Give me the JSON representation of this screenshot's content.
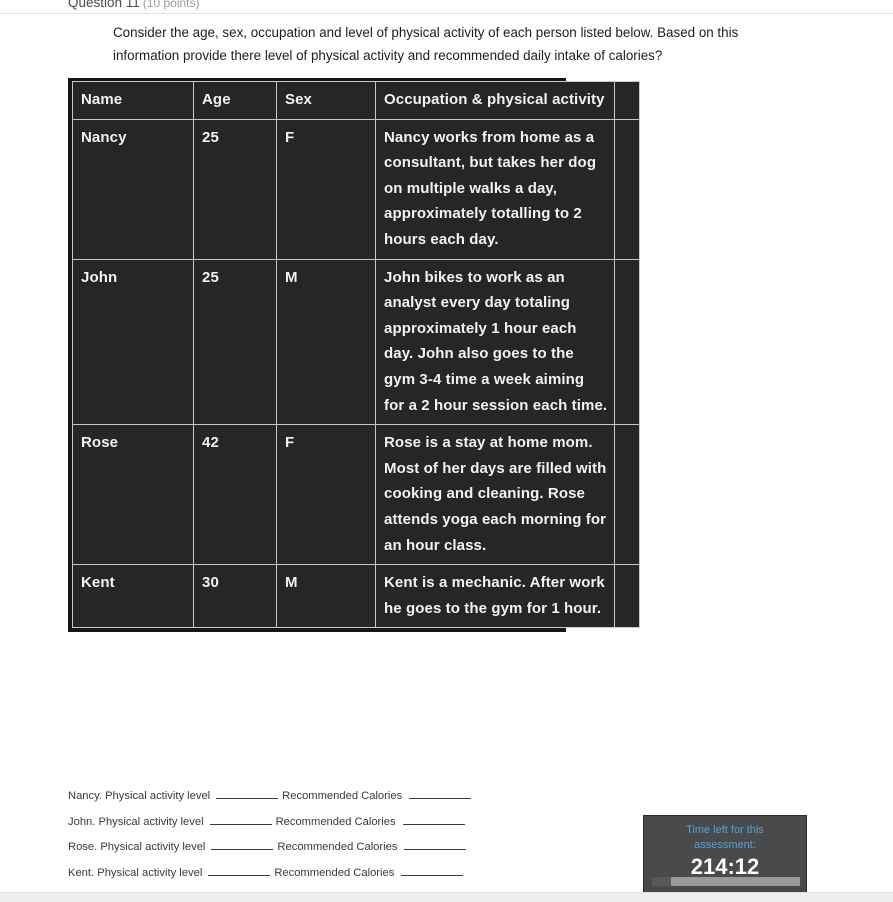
{
  "header": {
    "question_title": "Question 11",
    "points": "(10 points)"
  },
  "prompt": {
    "line1": "Consider the age, sex, occupation and level of physical activity of each person listed below. Based on this",
    "line2": "information provide there level of physical activity and  recommended daily intake of calories?"
  },
  "table": {
    "columns": [
      "Name",
      "Age",
      "Sex",
      "Occupation & physical activity"
    ],
    "rows": [
      {
        "name": "Nancy",
        "age": "25",
        "sex": "F",
        "occupation": "Nancy works from home as a consultant, but takes her dog on multiple walks a day, approximately totalling to 2 hours each day."
      },
      {
        "name": "John",
        "age": "25",
        "sex": "M",
        "occupation": "John bikes to work as an analyst every day totaling approximately 1 hour each day. John also goes to the gym 3-4 time a week aiming for a 2 hour session each time."
      },
      {
        "name": "Rose",
        "age": "42",
        "sex": "F",
        "occupation": "Rose is a stay at home mom. Most of her days are filled with cooking and cleaning. Rose attends yoga each morning for an hour class."
      },
      {
        "name": "Kent",
        "age": "30",
        "sex": "M",
        "occupation": "Kent is a mechanic. After work he goes to the gym for 1 hour."
      }
    ]
  },
  "answers": [
    {
      "person": "Nancy. Physical activity level",
      "calories_label": "Recommended Calories"
    },
    {
      "person": "John. Physical activity level",
      "calories_label": "Recommended Calories"
    },
    {
      "person": "Rose. Physical activity level",
      "calories_label": "Recommended Calories"
    },
    {
      "person": "Kent. Physical activity level",
      "calories_label": "Recommended Calories"
    }
  ],
  "timer": {
    "label_line1": "Time left for this",
    "label_line2": "assessment:",
    "value": "214:12",
    "progress_percent": 13,
    "label_color": "#54a0d8",
    "value_color": "#ffffff",
    "box_color": "#4a4a4a"
  }
}
